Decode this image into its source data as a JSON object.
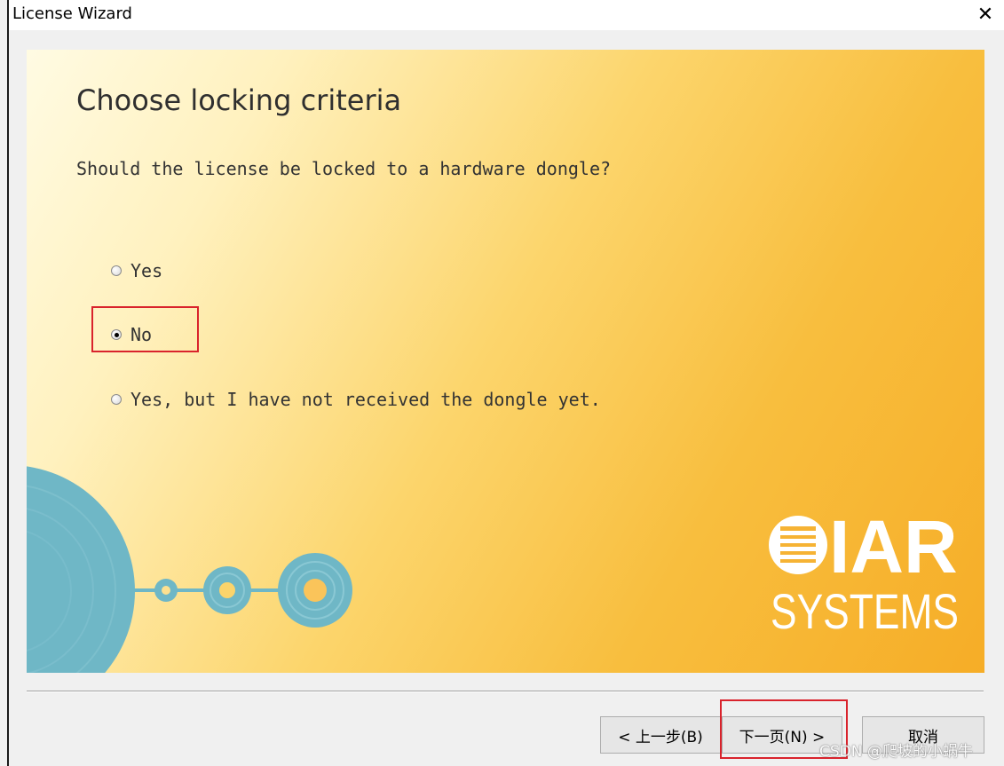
{
  "window": {
    "title": "License Wizard",
    "close_glyph": "✕"
  },
  "page": {
    "heading": "Choose locking criteria",
    "question": "Should the license be locked to a hardware dongle?",
    "options": [
      {
        "label": "Yes",
        "selected": false
      },
      {
        "label": "No",
        "selected": true
      },
      {
        "label": "Yes, but I have not received the dongle yet.",
        "selected": false
      }
    ]
  },
  "logo": {
    "line1": "IAR",
    "line2": "SYSTEMS"
  },
  "buttons": {
    "back": "< 上一步(B)",
    "next": "下一页(N) >",
    "cancel": "取消"
  },
  "watermark": "CSDN @爬坡的小蜗牛",
  "colors": {
    "highlight": "#d9232c",
    "accent_blue": "#6fb7c6",
    "banner_orange": "#f6ad27"
  }
}
